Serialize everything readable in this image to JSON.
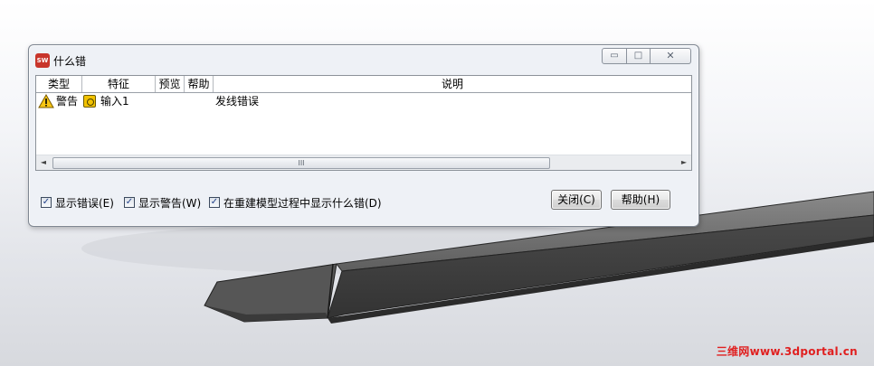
{
  "window": {
    "title": "什么错",
    "app_icon_text": "SW",
    "minimize_glyph": "▭",
    "maximize_glyph": "□",
    "close_glyph": "✕"
  },
  "list": {
    "columns": [
      "类型",
      "特征",
      "预览",
      "帮助",
      "说明"
    ],
    "rows": [
      {
        "type": "警告",
        "feature": "输入1",
        "preview": "",
        "help": "",
        "description": "发线错误"
      }
    ],
    "scroll_thumb_grip": "III",
    "scroll_left": "◄",
    "scroll_right": "►"
  },
  "options": [
    {
      "label": "显示错误(E)",
      "checked": true
    },
    {
      "label": "显示警告(W)",
      "checked": true
    },
    {
      "label": "在重建模型过程中显示什么错(D)",
      "checked": true
    }
  ],
  "checkmark": "✓",
  "buttons": {
    "close": "关闭(C)",
    "help": "帮助(H)"
  },
  "watermark": "三维网www.3dportal.cn",
  "colors": {
    "part_dark": "#4a4a4a",
    "part_light": "#6e6e6e",
    "warning": "#f7c614",
    "watermark": "#e01f1f"
  }
}
